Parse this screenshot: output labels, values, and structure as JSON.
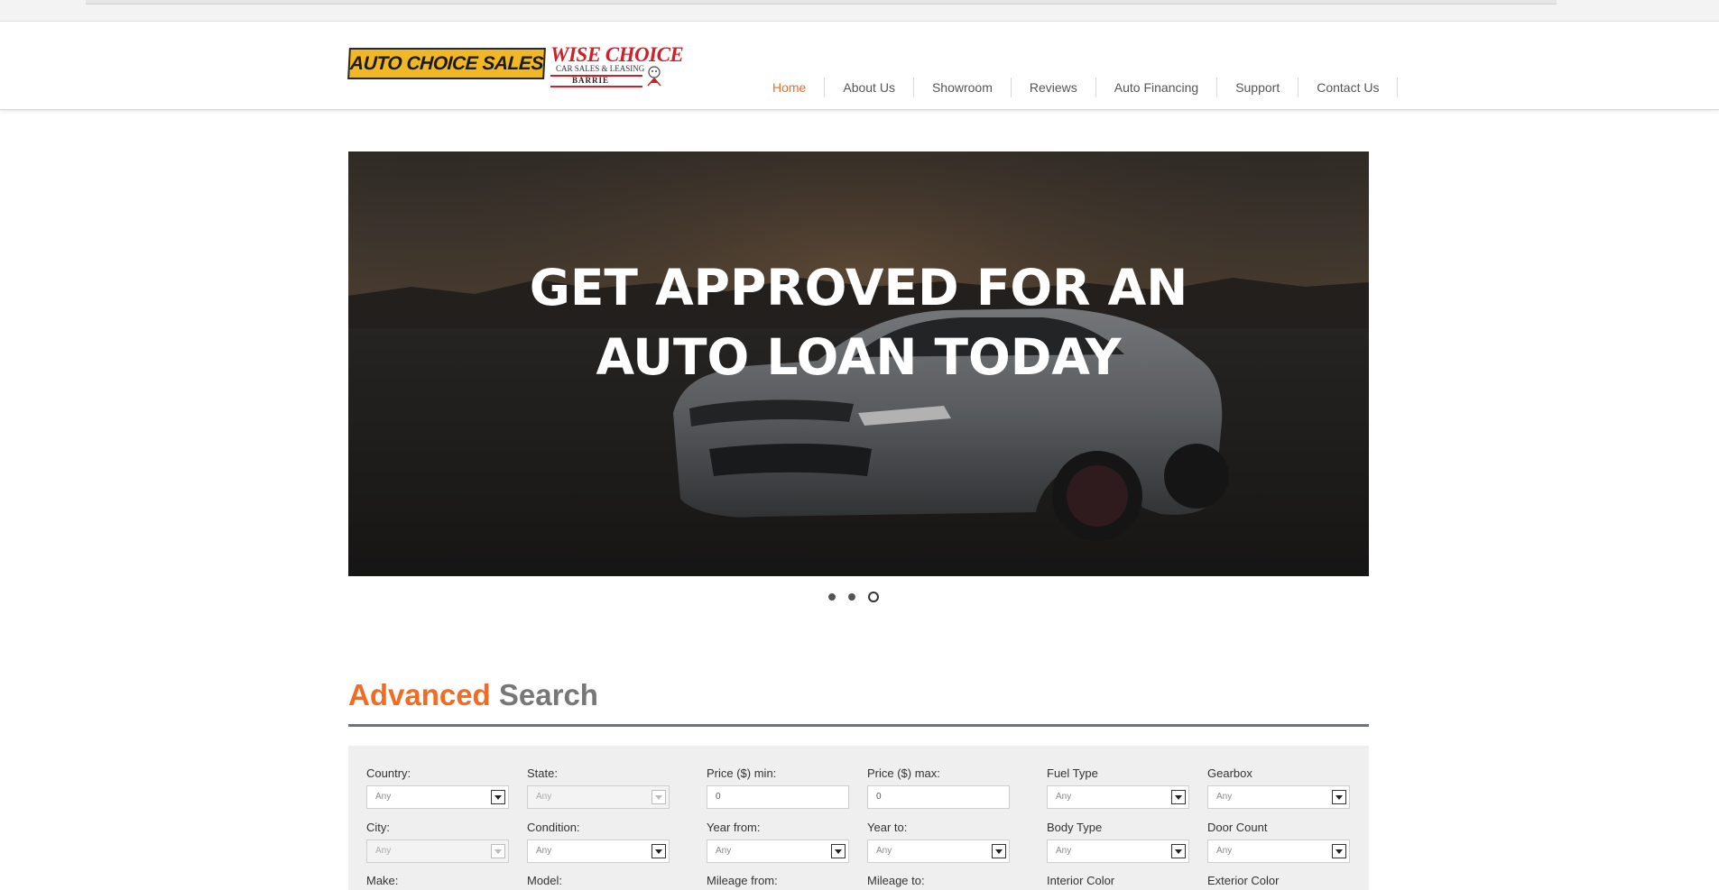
{
  "logo": {
    "primary_text": "AUTO CHOICE SALES",
    "secondary_title": "WISE CHOICE",
    "secondary_subtitle": "CAR SALES & LEASING",
    "secondary_city": "BARRIE"
  },
  "nav": {
    "items": [
      {
        "label": "Home",
        "active": true
      },
      {
        "label": "About Us"
      },
      {
        "label": "Showroom"
      },
      {
        "label": "Reviews"
      },
      {
        "label": "Auto Financing"
      },
      {
        "label": "Support"
      },
      {
        "label": "Contact Us"
      }
    ]
  },
  "hero": {
    "line1": "GET APPROVED FOR AN",
    "line2": "AUTO LOAN TODAY",
    "slide_count": 3,
    "active_slide": 3
  },
  "search": {
    "title_accent": "Advanced",
    "title_rest": "Search",
    "fields": {
      "country": {
        "label": "Country:",
        "value": "Any"
      },
      "state": {
        "label": "State:",
        "value": "Any"
      },
      "price_min": {
        "label": "Price ($) min:",
        "value": "0"
      },
      "price_max": {
        "label": "Price ($) max:",
        "value": "0"
      },
      "fuel_type": {
        "label": "Fuel Type",
        "value": "Any"
      },
      "gearbox": {
        "label": "Gearbox",
        "value": "Any"
      },
      "city": {
        "label": "City:",
        "value": "Any"
      },
      "condition": {
        "label": "Condition:",
        "value": "Any"
      },
      "year_from": {
        "label": "Year from:",
        "value": "Any"
      },
      "year_to": {
        "label": "Year to:",
        "value": "Any"
      },
      "body_type": {
        "label": "Body Type",
        "value": "Any"
      },
      "door_count": {
        "label": "Door Count",
        "value": "Any"
      },
      "make": {
        "label": "Make:"
      },
      "model": {
        "label": "Model:"
      },
      "mileage_from": {
        "label": "Mileage from:"
      },
      "mileage_to": {
        "label": "Mileage to:"
      },
      "interior_color": {
        "label": "Interior Color"
      },
      "exterior_color": {
        "label": "Exterior Color"
      }
    }
  },
  "colors": {
    "accent": "#f26b21",
    "logo_yellow": "#f1b824",
    "logo_red": "#d02027",
    "rule": "#6b7280"
  }
}
